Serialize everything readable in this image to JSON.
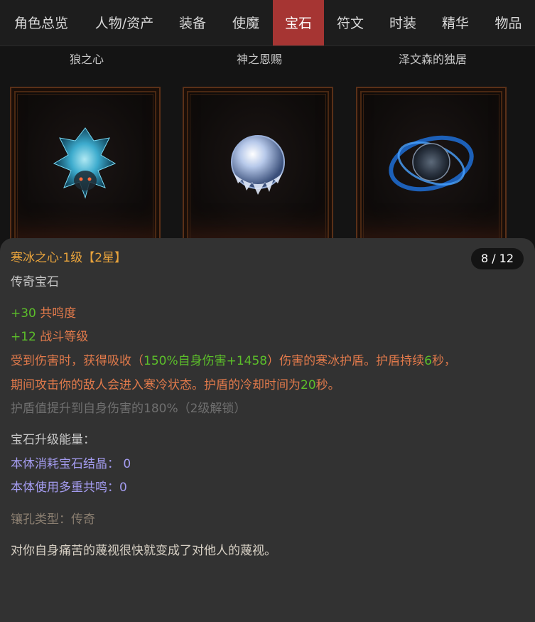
{
  "tabs": [
    {
      "label": "角色总览",
      "active": false
    },
    {
      "label": "人物/资产",
      "active": false
    },
    {
      "label": "装备",
      "active": false
    },
    {
      "label": "使魔",
      "active": false
    },
    {
      "label": "宝石",
      "active": true
    },
    {
      "label": "符文",
      "active": false
    },
    {
      "label": "时装",
      "active": false
    },
    {
      "label": "精华",
      "active": false
    },
    {
      "label": "物品",
      "active": false
    }
  ],
  "gems": [
    {
      "name": "狼之心",
      "icon": "wolf-heart-gem-icon"
    },
    {
      "name": "神之恩赐",
      "icon": "gods-gift-gem-icon"
    },
    {
      "name": "泽文森的独居",
      "icon": "zerwin-solitude-gem-icon"
    }
  ],
  "detail": {
    "title_name": "寒冰之心·1级",
    "title_star": "【2星】",
    "count": "8 / 12",
    "type": "传奇宝石",
    "stat1_value": "+30",
    "stat1_label": " 共鸣度",
    "stat2_value": "+12",
    "stat2_label": " 战斗等级",
    "effect": {
      "p1": "受到伤害时，获得吸收（",
      "g1": "150%自身伤害+1458",
      "p2": "）伤害的寒冰护盾。护盾持续",
      "g2": "6",
      "p3": "秒，",
      "p4": "期间攻击你的敌人会进入寒冷状态。护盾的冷却时间为",
      "g3": "20",
      "p5": "秒。"
    },
    "locked_text": "护盾值提升到自身伤害的180%（2级解锁）",
    "upgrade_heading": "宝石升级能量：",
    "upgrade_line1": "本体消耗宝石结晶： 0",
    "upgrade_line2": "本体使用多重共鸣：0",
    "socket_type": "镶孔类型：传奇",
    "flavor": "对你自身痛苦的蔑视很快就变成了对他人的蔑视。"
  },
  "colors": {
    "active_tab": "#a63533",
    "title": "#e8a33c",
    "green": "#5cbf2a",
    "orange": "#e27a4b",
    "blue": "#a49cf0"
  }
}
